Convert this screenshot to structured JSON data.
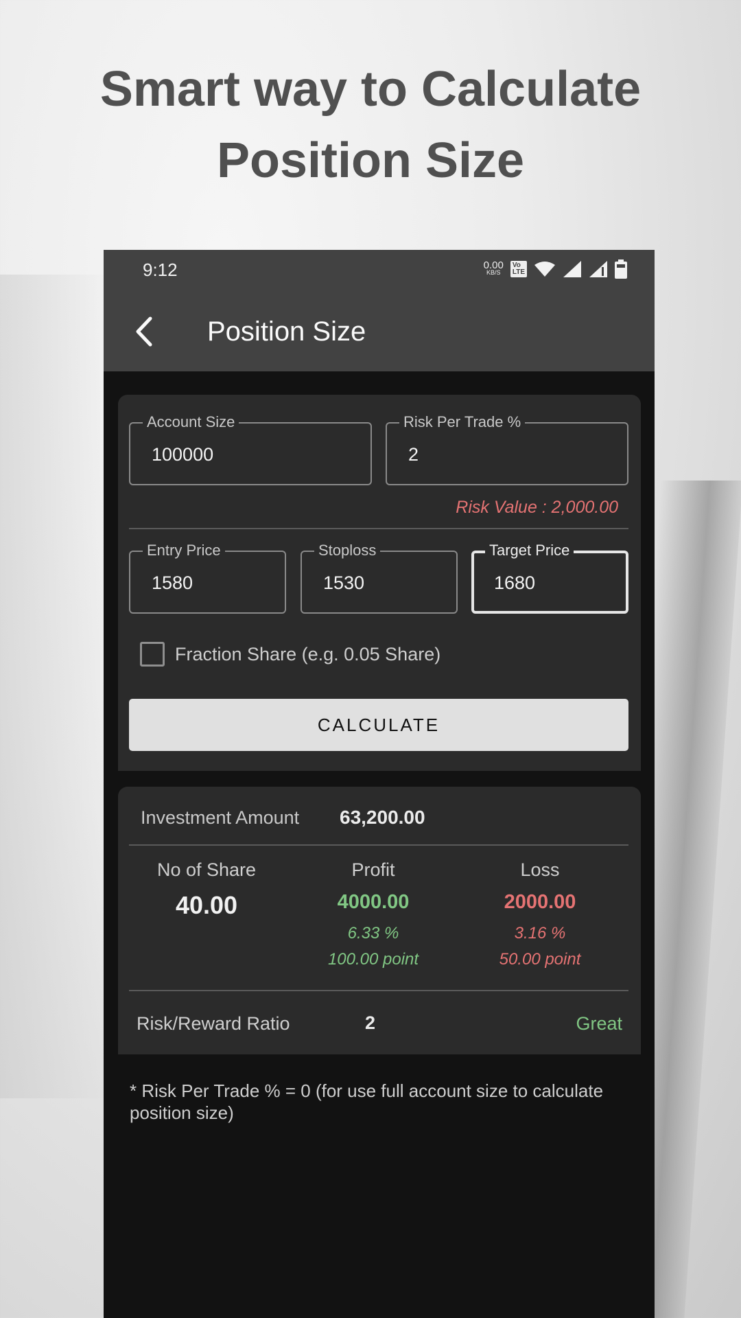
{
  "promo": {
    "headline_line1": "Smart way to Calculate",
    "headline_line2": "Position Size"
  },
  "status_bar": {
    "time": "9:12",
    "net_speed_value": "0.00",
    "net_speed_unit": "KB/S",
    "volte_label": "Vo LTE 1",
    "icons": [
      "volte-icon",
      "wifi-icon",
      "signal-icon",
      "signal-icon-2",
      "battery-icon"
    ]
  },
  "app_bar": {
    "title": "Position Size",
    "back_icon": "chevron-left-icon"
  },
  "inputs": {
    "account_size": {
      "label": "Account Size",
      "value": "100000"
    },
    "risk_per_trade": {
      "label": "Risk Per Trade %",
      "value": "2"
    },
    "risk_value_text": "Risk Value : 2,000.00",
    "entry_price": {
      "label": "Entry Price",
      "value": "1580"
    },
    "stoploss": {
      "label": "Stoploss",
      "value": "1530"
    },
    "target_price": {
      "label": "Target Price",
      "value": "1680",
      "focused": true
    },
    "fraction_share": {
      "label": "Fraction Share (e.g. 0.05 Share)",
      "checked": false
    },
    "calculate_label": "CALCULATE"
  },
  "results": {
    "investment_label": "Investment Amount",
    "investment_value": "63,200.00",
    "shares": {
      "label": "No of Share",
      "value": "40.00"
    },
    "profit": {
      "label": "Profit",
      "value": "4000.00",
      "percent": "6.33 %",
      "points": "100.00 point"
    },
    "loss": {
      "label": "Loss",
      "value": "2000.00",
      "percent": "3.16 %",
      "points": "50.00 point"
    },
    "rr_label": "Risk/Reward Ratio",
    "rr_value": "2",
    "rr_rating": "Great"
  },
  "footnote": "* Risk Per Trade %  = 0 (for use full account size to calculate position size)",
  "colors": {
    "profit": "#81c784",
    "loss": "#e57373",
    "app_bar": "#424242",
    "card": "#2b2b2b",
    "background": "#121212"
  }
}
